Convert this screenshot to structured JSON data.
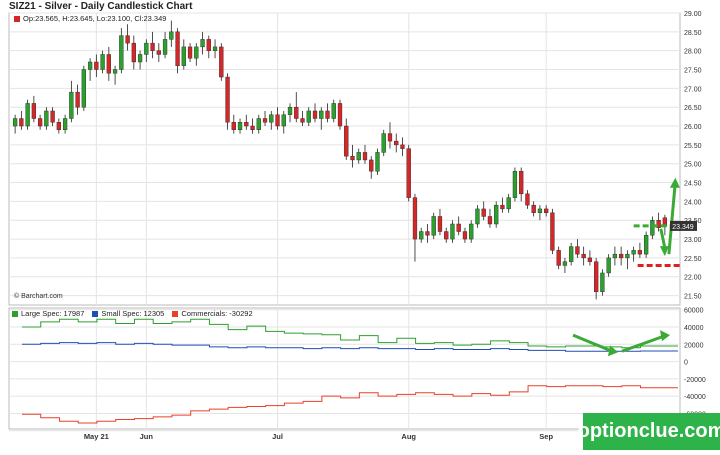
{
  "page": {
    "title": "SIZ21 - Silver - Daily Candlestick Chart",
    "ohlc_readout": "Op:23.565, H:23.645, Lo:23.100, Cl:23.349",
    "copyright": "© Barchart.com",
    "watermark": "optionclue.com"
  },
  "colors": {
    "up_candle": "#2ca02c",
    "down_candle": "#d62728",
    "large_spec": "#2ca02c",
    "small_spec": "#1f4fb4",
    "commercials": "#e8402a",
    "annotation_green": "#3aaa35",
    "annotation_red": "#e02020",
    "last_price_box": "#333333"
  },
  "chart_data": [
    {
      "type": "candlestick",
      "title": "SIZ21 - Silver - Daily Candlestick Chart",
      "ylim": [
        21.25,
        29.0
      ],
      "y_ticks": [
        "21.50",
        "22.00",
        "22.50",
        "23.00",
        "23.50",
        "24.00",
        "24.50",
        "25.00",
        "25.50",
        "26.00",
        "26.50",
        "27.00",
        "27.50",
        "28.00",
        "28.50",
        "29.00"
      ],
      "x_ticks": [
        {
          "label": "May 21",
          "day": 13
        },
        {
          "label": "Jun",
          "day": 21
        },
        {
          "label": "Jul",
          "day": 42
        },
        {
          "label": "Aug",
          "day": 63
        },
        {
          "label": "Sep",
          "day": 85
        }
      ],
      "last_price_label": "23.349",
      "candles": [
        {
          "o": 26.0,
          "h": 26.3,
          "l": 25.8,
          "c": 26.2
        },
        {
          "o": 26.2,
          "h": 26.4,
          "l": 25.9,
          "c": 26.0
        },
        {
          "o": 26.0,
          "h": 26.7,
          "l": 25.9,
          "c": 26.6
        },
        {
          "o": 26.6,
          "h": 26.8,
          "l": 26.1,
          "c": 26.2
        },
        {
          "o": 26.2,
          "h": 26.3,
          "l": 25.9,
          "c": 26.0
        },
        {
          "o": 26.0,
          "h": 26.5,
          "l": 25.9,
          "c": 26.4
        },
        {
          "o": 26.4,
          "h": 26.5,
          "l": 26.0,
          "c": 26.1
        },
        {
          "o": 26.1,
          "h": 26.2,
          "l": 25.8,
          "c": 25.9
        },
        {
          "o": 25.9,
          "h": 26.3,
          "l": 25.8,
          "c": 26.2
        },
        {
          "o": 26.2,
          "h": 27.2,
          "l": 26.1,
          "c": 26.9
        },
        {
          "o": 26.9,
          "h": 27.1,
          "l": 26.3,
          "c": 26.5
        },
        {
          "o": 26.5,
          "h": 27.6,
          "l": 26.4,
          "c": 27.5
        },
        {
          "o": 27.5,
          "h": 27.8,
          "l": 27.2,
          "c": 27.7
        },
        {
          "o": 27.7,
          "h": 27.9,
          "l": 27.3,
          "c": 27.5
        },
        {
          "o": 27.5,
          "h": 28.0,
          "l": 27.4,
          "c": 27.9
        },
        {
          "o": 27.9,
          "h": 28.1,
          "l": 27.2,
          "c": 27.4
        },
        {
          "o": 27.4,
          "h": 27.6,
          "l": 27.1,
          "c": 27.5
        },
        {
          "o": 27.5,
          "h": 28.6,
          "l": 27.4,
          "c": 28.4
        },
        {
          "o": 28.4,
          "h": 28.7,
          "l": 28.0,
          "c": 28.2
        },
        {
          "o": 28.2,
          "h": 28.4,
          "l": 27.5,
          "c": 27.7
        },
        {
          "o": 27.7,
          "h": 28.0,
          "l": 27.5,
          "c": 27.9
        },
        {
          "o": 27.9,
          "h": 28.3,
          "l": 27.7,
          "c": 28.2
        },
        {
          "o": 28.2,
          "h": 28.5,
          "l": 27.8,
          "c": 28.0
        },
        {
          "o": 28.0,
          "h": 28.2,
          "l": 27.7,
          "c": 27.9
        },
        {
          "o": 27.9,
          "h": 28.5,
          "l": 27.8,
          "c": 28.3
        },
        {
          "o": 28.3,
          "h": 28.8,
          "l": 28.1,
          "c": 28.5
        },
        {
          "o": 28.5,
          "h": 28.6,
          "l": 27.4,
          "c": 27.6
        },
        {
          "o": 27.6,
          "h": 28.3,
          "l": 27.5,
          "c": 28.1
        },
        {
          "o": 28.1,
          "h": 28.2,
          "l": 27.7,
          "c": 27.8
        },
        {
          "o": 27.8,
          "h": 28.2,
          "l": 27.6,
          "c": 28.1
        },
        {
          "o": 28.1,
          "h": 28.5,
          "l": 27.9,
          "c": 28.3
        },
        {
          "o": 28.3,
          "h": 28.4,
          "l": 27.8,
          "c": 28.0
        },
        {
          "o": 28.0,
          "h": 28.3,
          "l": 27.8,
          "c": 28.1
        },
        {
          "o": 28.1,
          "h": 28.2,
          "l": 27.2,
          "c": 27.3
        },
        {
          "o": 27.3,
          "h": 27.4,
          "l": 25.9,
          "c": 26.1
        },
        {
          "o": 26.1,
          "h": 26.3,
          "l": 25.8,
          "c": 25.9
        },
        {
          "o": 25.9,
          "h": 26.2,
          "l": 25.8,
          "c": 26.1
        },
        {
          "o": 26.1,
          "h": 26.3,
          "l": 25.9,
          "c": 26.0
        },
        {
          "o": 26.0,
          "h": 26.2,
          "l": 25.8,
          "c": 25.9
        },
        {
          "o": 25.9,
          "h": 26.3,
          "l": 25.8,
          "c": 26.2
        },
        {
          "o": 26.2,
          "h": 26.4,
          "l": 26.0,
          "c": 26.1
        },
        {
          "o": 26.1,
          "h": 26.4,
          "l": 25.9,
          "c": 26.3
        },
        {
          "o": 26.3,
          "h": 26.5,
          "l": 25.9,
          "c": 26.0
        },
        {
          "o": 26.0,
          "h": 26.4,
          "l": 25.8,
          "c": 26.3
        },
        {
          "o": 26.3,
          "h": 26.6,
          "l": 26.1,
          "c": 26.5
        },
        {
          "o": 26.5,
          "h": 26.9,
          "l": 26.1,
          "c": 26.2
        },
        {
          "o": 26.2,
          "h": 26.4,
          "l": 26.0,
          "c": 26.1
        },
        {
          "o": 26.1,
          "h": 26.5,
          "l": 26.0,
          "c": 26.4
        },
        {
          "o": 26.4,
          "h": 26.6,
          "l": 26.1,
          "c": 26.2
        },
        {
          "o": 26.2,
          "h": 26.5,
          "l": 25.9,
          "c": 26.4
        },
        {
          "o": 26.4,
          "h": 26.6,
          "l": 26.1,
          "c": 26.2
        },
        {
          "o": 26.2,
          "h": 26.7,
          "l": 26.1,
          "c": 26.6
        },
        {
          "o": 26.6,
          "h": 26.7,
          "l": 25.9,
          "c": 26.0
        },
        {
          "o": 26.0,
          "h": 26.2,
          "l": 25.1,
          "c": 25.2
        },
        {
          "o": 25.2,
          "h": 25.5,
          "l": 24.9,
          "c": 25.1
        },
        {
          "o": 25.1,
          "h": 25.4,
          "l": 25.0,
          "c": 25.3
        },
        {
          "o": 25.3,
          "h": 25.5,
          "l": 25.0,
          "c": 25.1
        },
        {
          "o": 25.1,
          "h": 25.2,
          "l": 24.6,
          "c": 24.8
        },
        {
          "o": 24.8,
          "h": 25.4,
          "l": 24.7,
          "c": 25.3
        },
        {
          "o": 25.3,
          "h": 25.9,
          "l": 25.2,
          "c": 25.8
        },
        {
          "o": 25.8,
          "h": 26.1,
          "l": 25.4,
          "c": 25.6
        },
        {
          "o": 25.6,
          "h": 25.8,
          "l": 25.3,
          "c": 25.5
        },
        {
          "o": 25.5,
          "h": 25.7,
          "l": 25.2,
          "c": 25.4
        },
        {
          "o": 25.4,
          "h": 25.5,
          "l": 24.0,
          "c": 24.1
        },
        {
          "o": 24.1,
          "h": 24.2,
          "l": 22.4,
          "c": 23.0
        },
        {
          "o": 23.0,
          "h": 23.3,
          "l": 22.9,
          "c": 23.2
        },
        {
          "o": 23.2,
          "h": 23.4,
          "l": 22.9,
          "c": 23.1
        },
        {
          "o": 23.1,
          "h": 23.7,
          "l": 23.0,
          "c": 23.6
        },
        {
          "o": 23.6,
          "h": 23.8,
          "l": 23.1,
          "c": 23.2
        },
        {
          "o": 23.2,
          "h": 23.3,
          "l": 22.9,
          "c": 23.0
        },
        {
          "o": 23.0,
          "h": 23.5,
          "l": 22.9,
          "c": 23.4
        },
        {
          "o": 23.4,
          "h": 23.6,
          "l": 23.1,
          "c": 23.2
        },
        {
          "o": 23.2,
          "h": 23.3,
          "l": 22.9,
          "c": 23.0
        },
        {
          "o": 23.0,
          "h": 23.5,
          "l": 22.9,
          "c": 23.4
        },
        {
          "o": 23.4,
          "h": 23.9,
          "l": 23.3,
          "c": 23.8
        },
        {
          "o": 23.8,
          "h": 24.0,
          "l": 23.5,
          "c": 23.6
        },
        {
          "o": 23.6,
          "h": 23.8,
          "l": 23.3,
          "c": 23.4
        },
        {
          "o": 23.4,
          "h": 24.0,
          "l": 23.3,
          "c": 23.9
        },
        {
          "o": 23.9,
          "h": 24.1,
          "l": 23.7,
          "c": 23.8
        },
        {
          "o": 23.8,
          "h": 24.2,
          "l": 23.7,
          "c": 24.1
        },
        {
          "o": 24.1,
          "h": 24.9,
          "l": 24.0,
          "c": 24.8
        },
        {
          "o": 24.8,
          "h": 24.9,
          "l": 24.0,
          "c": 24.2
        },
        {
          "o": 24.2,
          "h": 24.3,
          "l": 23.8,
          "c": 23.9
        },
        {
          "o": 23.9,
          "h": 24.0,
          "l": 23.6,
          "c": 23.7
        },
        {
          "o": 23.7,
          "h": 23.9,
          "l": 23.5,
          "c": 23.8
        },
        {
          "o": 23.8,
          "h": 23.9,
          "l": 23.6,
          "c": 23.7
        },
        {
          "o": 23.7,
          "h": 23.8,
          "l": 22.6,
          "c": 22.7
        },
        {
          "o": 22.7,
          "h": 22.8,
          "l": 22.2,
          "c": 22.3
        },
        {
          "o": 22.3,
          "h": 22.5,
          "l": 22.1,
          "c": 22.4
        },
        {
          "o": 22.4,
          "h": 22.9,
          "l": 22.3,
          "c": 22.8
        },
        {
          "o": 22.8,
          "h": 23.0,
          "l": 22.5,
          "c": 22.6
        },
        {
          "o": 22.6,
          "h": 22.8,
          "l": 22.3,
          "c": 22.5
        },
        {
          "o": 22.5,
          "h": 22.7,
          "l": 22.3,
          "c": 22.4
        },
        {
          "o": 22.4,
          "h": 22.5,
          "l": 21.4,
          "c": 21.6
        },
        {
          "o": 21.6,
          "h": 22.2,
          "l": 21.5,
          "c": 22.1
        },
        {
          "o": 22.1,
          "h": 22.6,
          "l": 22.0,
          "c": 22.5
        },
        {
          "o": 22.5,
          "h": 22.8,
          "l": 22.3,
          "c": 22.6
        },
        {
          "o": 22.6,
          "h": 22.8,
          "l": 22.3,
          "c": 22.5
        },
        {
          "o": 22.5,
          "h": 22.7,
          "l": 22.2,
          "c": 22.6
        },
        {
          "o": 22.6,
          "h": 22.8,
          "l": 22.4,
          "c": 22.7
        },
        {
          "o": 22.7,
          "h": 22.9,
          "l": 22.5,
          "c": 22.6
        },
        {
          "o": 22.6,
          "h": 23.2,
          "l": 22.5,
          "c": 23.1
        },
        {
          "o": 23.1,
          "h": 23.6,
          "l": 23.0,
          "c": 23.5
        },
        {
          "o": 23.5,
          "h": 23.7,
          "l": 23.2,
          "c": 23.3
        },
        {
          "o": 23.565,
          "h": 23.645,
          "l": 23.1,
          "c": 23.349
        }
      ],
      "annotations": {
        "resistance_level": 23.35,
        "support_level": 22.3,
        "up_arrow_target": 24.6,
        "down_arrow_target": 22.6
      }
    },
    {
      "type": "line",
      "title": "",
      "ylim": [
        -78000,
        62000
      ],
      "y_ticks": [
        "60000",
        "40000",
        "20000",
        "0",
        "-20000",
        "-40000",
        "-60000",
        "-80000"
      ],
      "series": [
        {
          "name": "Large Spec: 17987",
          "legend": "Large Spec: 17987",
          "color": "#2ca02c",
          "step": true,
          "values": [
            40000,
            40000,
            40000,
            46000,
            46000,
            46000,
            49000,
            49000,
            49000,
            46000,
            46000,
            46000,
            49000,
            49000,
            49000,
            44000,
            44000,
            44000,
            49000,
            49000,
            49000,
            44000,
            44000,
            44000,
            46000,
            46000,
            46000,
            49000,
            49000,
            49000,
            43000,
            43000,
            43000,
            37000,
            37000,
            37000,
            41000,
            41000,
            41000,
            35000,
            35000,
            35000,
            33000,
            33000,
            33000,
            32000,
            32000,
            32000,
            31000,
            31000,
            31000,
            25000,
            25000,
            25000,
            30000,
            30000,
            30000,
            22000,
            22000,
            22000,
            27000,
            27000,
            27000,
            21000,
            21000,
            21000,
            22000,
            22000,
            22000,
            19000,
            19000,
            19000,
            20000,
            20000,
            20000,
            24000,
            24000,
            24000,
            22000,
            22000,
            22000,
            18000,
            18000,
            18000,
            17000,
            17000,
            17000,
            18000,
            18000,
            18000,
            18000,
            18000,
            18000,
            17000,
            17000,
            17000,
            16000,
            16000,
            16000,
            17987,
            17987,
            17987,
            17987,
            17987,
            17987
          ]
        },
        {
          "name": "Small Spec: 12305",
          "legend": "Small Spec: 12305",
          "color": "#1f4fb4",
          "step": true,
          "values": [
            20000,
            20000,
            20000,
            21000,
            21000,
            21000,
            22000,
            22000,
            22000,
            21000,
            21000,
            21000,
            22000,
            22000,
            22000,
            20000,
            20000,
            20000,
            21000,
            21000,
            21000,
            20000,
            20000,
            20000,
            19000,
            19000,
            19000,
            19000,
            19000,
            19000,
            17000,
            17000,
            17000,
            16000,
            16000,
            16000,
            17000,
            17000,
            17000,
            16000,
            16000,
            16000,
            16000,
            16000,
            16000,
            15000,
            15000,
            15000,
            16000,
            16000,
            16000,
            15000,
            15000,
            15000,
            16000,
            16000,
            16000,
            15000,
            15000,
            15000,
            15000,
            15000,
            15000,
            14000,
            14000,
            14000,
            15000,
            15000,
            15000,
            14000,
            14000,
            14000,
            14000,
            14000,
            14000,
            15000,
            15000,
            15000,
            14000,
            14000,
            14000,
            13000,
            13000,
            13000,
            13000,
            13000,
            13000,
            12000,
            12000,
            12000,
            12000,
            12000,
            12000,
            12000,
            12000,
            12000,
            12000,
            12000,
            12000,
            12305,
            12305,
            12305,
            12305,
            12305,
            12305
          ]
        },
        {
          "name": "Commercials: -30292",
          "legend": "Commercials: -30292",
          "color": "#e8402a",
          "step": true,
          "values": [
            -61000,
            -61000,
            -61000,
            -65000,
            -65000,
            -65000,
            -69000,
            -69000,
            -69000,
            -71000,
            -71000,
            -71000,
            -69000,
            -69000,
            -69000,
            -67000,
            -67000,
            -67000,
            -66000,
            -66000,
            -66000,
            -64000,
            -64000,
            -64000,
            -62000,
            -62000,
            -62000,
            -57000,
            -57000,
            -57000,
            -55000,
            -55000,
            -55000,
            -53000,
            -53000,
            -53000,
            -52000,
            -52000,
            -52000,
            -51000,
            -51000,
            -51000,
            -48000,
            -48000,
            -48000,
            -46000,
            -46000,
            -46000,
            -40000,
            -40000,
            -40000,
            -42000,
            -42000,
            -42000,
            -36000,
            -36000,
            -36000,
            -40000,
            -40000,
            -40000,
            -38000,
            -38000,
            -38000,
            -36000,
            -36000,
            -36000,
            -38000,
            -38000,
            -38000,
            -40000,
            -40000,
            -40000,
            -37000,
            -37000,
            -37000,
            -39000,
            -39000,
            -39000,
            -35000,
            -35000,
            -35000,
            -28000,
            -28000,
            -28000,
            -29000,
            -29000,
            -29000,
            -28000,
            -28000,
            -28000,
            -28000,
            -28000,
            -28000,
            -29000,
            -29000,
            -29000,
            -28000,
            -28000,
            -28000,
            -30292,
            -30292,
            -30292,
            -30292,
            -30292,
            -30292
          ]
        }
      ]
    }
  ]
}
